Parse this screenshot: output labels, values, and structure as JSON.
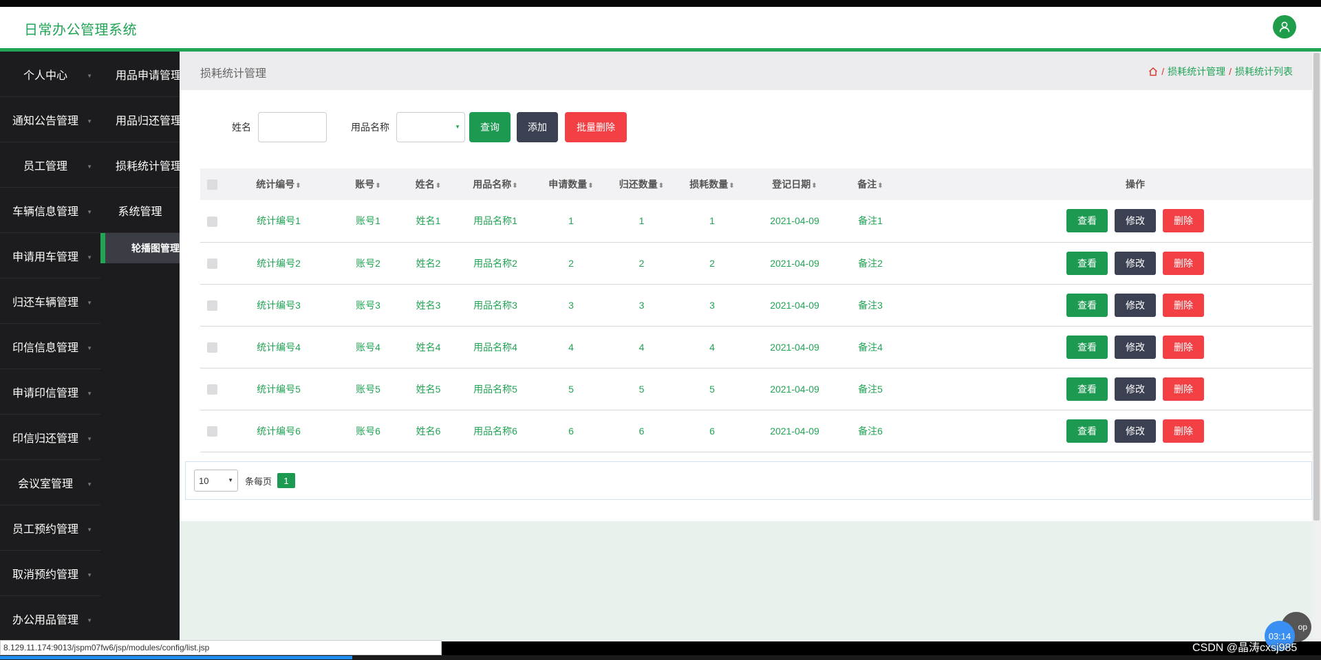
{
  "app": {
    "title": "日常办公管理系统"
  },
  "sidebar": {
    "col1": [
      "个人中心",
      "通知公告管理",
      "员工管理",
      "车辆信息管理",
      "申请用车管理",
      "归还车辆管理",
      "印信信息管理",
      "申请印信管理",
      "印信归还管理",
      "会议室管理",
      "员工预约管理",
      "取消预约管理",
      "办公用品管理"
    ],
    "col2": [
      "用品申请管理",
      "用品归还管理",
      "损耗统计管理",
      "系统管理"
    ],
    "active_sub": "轮播图管理"
  },
  "page": {
    "title": "损耗统计管理",
    "breadcrumb": [
      "损耗统计管理",
      "损耗统计列表"
    ]
  },
  "search": {
    "name_label": "姓名",
    "item_label": "用品名称",
    "query_btn": "查询",
    "add_btn": "添加",
    "batch_delete_btn": "批量删除"
  },
  "table": {
    "headers": [
      "统计编号",
      "账号",
      "姓名",
      "用品名称",
      "申请数量",
      "归还数量",
      "损耗数量",
      "登记日期",
      "备注",
      "操作"
    ],
    "sort_glyph": "⬍",
    "actions": {
      "view": "查看",
      "edit": "修改",
      "delete": "删除"
    },
    "rows": [
      [
        "统计编号1",
        "账号1",
        "姓名1",
        "用品名称1",
        "1",
        "1",
        "1",
        "2021-04-09",
        "备注1"
      ],
      [
        "统计编号2",
        "账号2",
        "姓名2",
        "用品名称2",
        "2",
        "2",
        "2",
        "2021-04-09",
        "备注2"
      ],
      [
        "统计编号3",
        "账号3",
        "姓名3",
        "用品名称3",
        "3",
        "3",
        "3",
        "2021-04-09",
        "备注3"
      ],
      [
        "统计编号4",
        "账号4",
        "姓名4",
        "用品名称4",
        "4",
        "4",
        "4",
        "2021-04-09",
        "备注4"
      ],
      [
        "统计编号5",
        "账号5",
        "姓名5",
        "用品名称5",
        "5",
        "5",
        "5",
        "2021-04-09",
        "备注5"
      ],
      [
        "统计编号6",
        "账号6",
        "姓名6",
        "用品名称6",
        "6",
        "6",
        "6",
        "2021-04-09",
        "备注6"
      ]
    ]
  },
  "pager": {
    "page_size": "10",
    "per_page_label": "条每页",
    "current_page": "1"
  },
  "statusbar": {
    "url": "8.129.11.174:9013/jspm07fw6/jsp/modules/config/list.jsp"
  },
  "overlay": {
    "timer": "03:14",
    "top_btn": "op",
    "watermark": "CSDN @晶涛cxsj985"
  },
  "colors": {
    "accent": "#22a455",
    "danger": "#f24045",
    "dark": "#3c4053"
  }
}
